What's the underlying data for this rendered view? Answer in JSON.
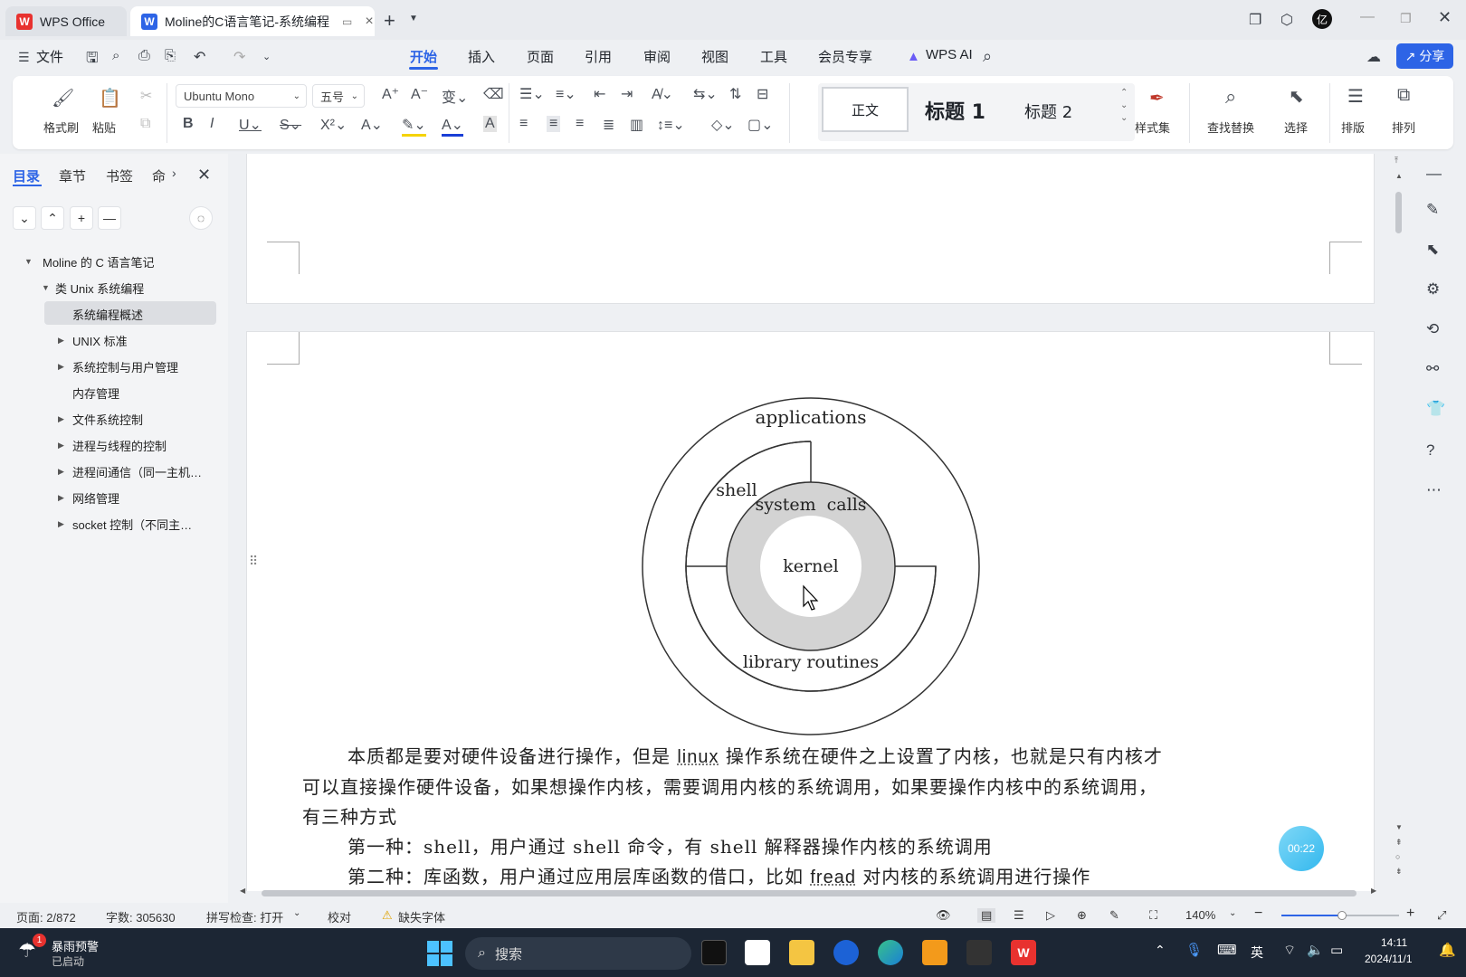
{
  "tabs": {
    "home_label": "WPS Office",
    "doc_label": "Moline的C语言笔记-系统编程"
  },
  "menu": {
    "file": "文件",
    "items": [
      "开始",
      "插入",
      "页面",
      "引用",
      "审阅",
      "视图",
      "工具",
      "会员专享",
      "WPS AI"
    ],
    "share": "分享"
  },
  "ribbon": {
    "format_painter": "格式刷",
    "paste": "粘贴",
    "font_name": "Ubuntu Mono",
    "font_size": "五号",
    "styles": [
      "正文",
      "标题 1",
      "标题 2"
    ],
    "style_set": "样式集",
    "find_replace": "查找替换",
    "select": "选择",
    "layout": "排版",
    "arrange": "排列"
  },
  "panel": {
    "tabs": [
      "目录",
      "章节",
      "书签",
      "命"
    ],
    "toc": [
      "Moline 的 C 语言笔记",
      "类 Unix 系统编程",
      "系统编程概述",
      "UNIX 标准",
      "系统控制与用户管理",
      "内存管理",
      "文件系统控制",
      "进程与线程的控制",
      "进程间通信（同一主机…",
      "网络管理",
      "socket 控制（不同主…"
    ]
  },
  "diagram": {
    "applications": "applications",
    "shell": "shell",
    "system_calls": "system  calls",
    "kernel": "kernel",
    "library_routines": "library routines"
  },
  "document": {
    "line1a": "本质都是要对硬件设备进行操作，但是 ",
    "line1_linux": "linux",
    "line1b": " 操作系统在硬件之上设置了内核，也就是只有内核才",
    "line2": "可以直接操作硬件设备，如果想操作内核，需要调用内核的系统调用，如果要操作内核中的系统调用，",
    "line3": "有三种方式",
    "line4": "第一种：shell，用户通过 shell 命令，有 shell 解释器操作内核的系统调用",
    "line5a": "第二种：库函数，用户通过应用层库函数的借口，比如 ",
    "line5_fread": "fread",
    "line5b": " 对内核的系统调用进行操作"
  },
  "timer": "00:22",
  "status": {
    "page": "页面: 2/872",
    "words": "字数: 305630",
    "spell": "拼写检查: 打开",
    "proof": "校对",
    "missing_font": "缺失字体",
    "zoom": "140%"
  },
  "taskbar": {
    "weather_title": "暴雨预警",
    "weather_sub": "已启动",
    "badge": "1",
    "search": "搜索",
    "ime": "英",
    "time": "14:11",
    "date": "2024/11/1"
  }
}
